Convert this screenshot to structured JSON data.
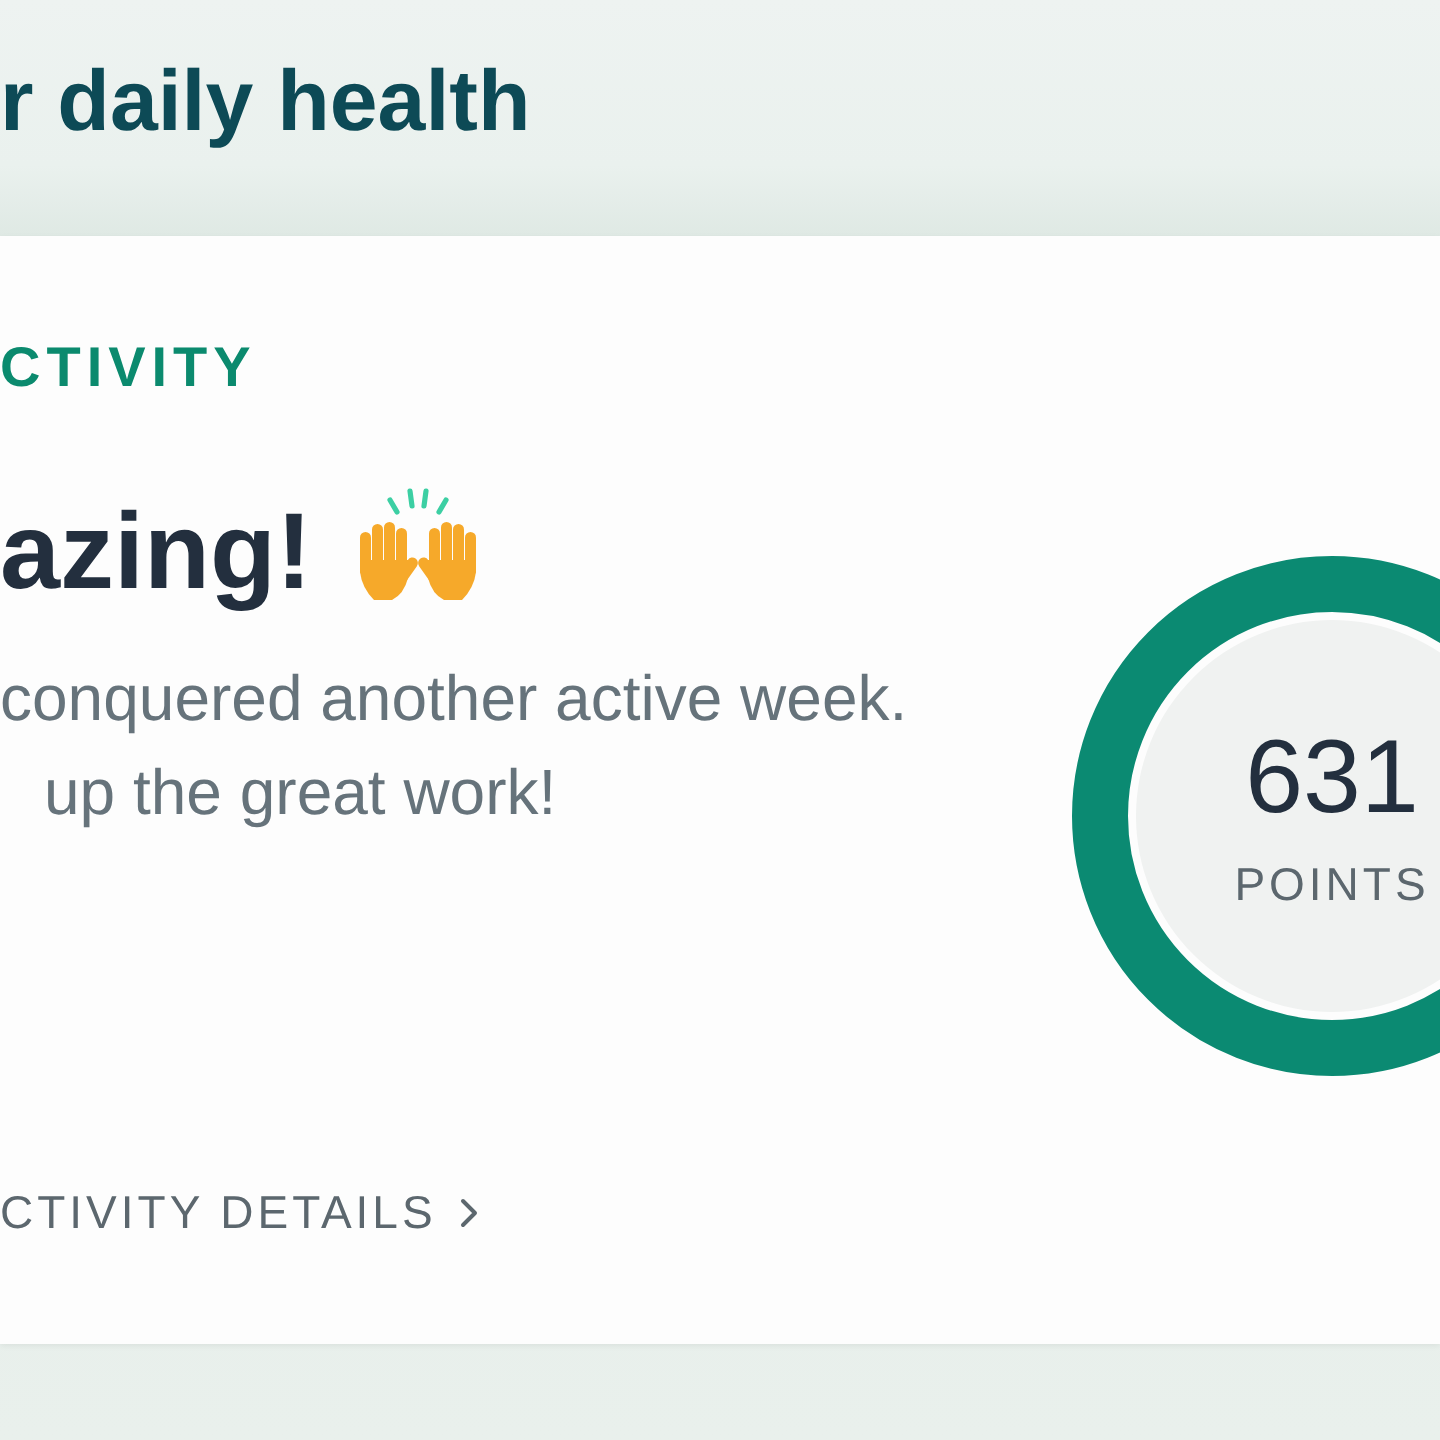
{
  "header": {
    "title": "r daily health"
  },
  "activity_card": {
    "section_label": "CTIVITY",
    "headline": "azing!",
    "message_lines": [
      "conquered another active week.",
      "up the great work!"
    ],
    "points": {
      "value": "631",
      "unit": "POINTS"
    },
    "details_link": {
      "label": "CTIVITY DETAILS"
    }
  }
}
